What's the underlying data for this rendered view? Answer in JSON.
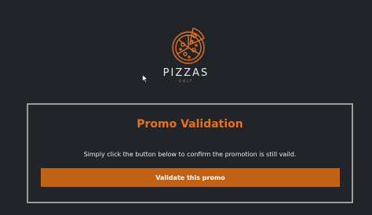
{
  "brand": {
    "name": "PIZZAS",
    "tagline": "ONLY",
    "logo_icon": "pizza-icon",
    "accent_color": "#e8711f"
  },
  "promo": {
    "title": "Promo Validation",
    "description": "Simply click the button below to confirm the promotion is still vaild.",
    "button_label": "Validate this promo",
    "button_color": "#bf6117"
  }
}
